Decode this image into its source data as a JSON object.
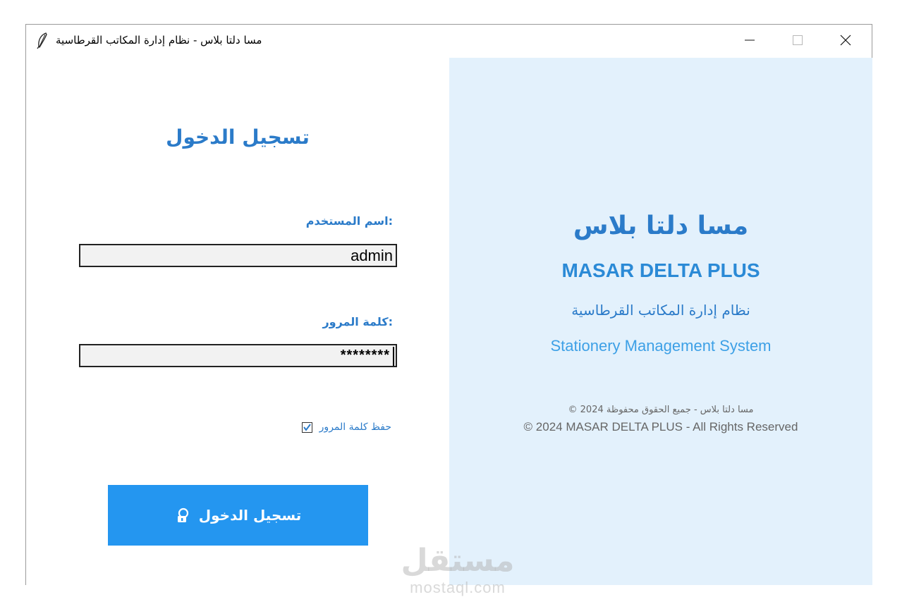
{
  "window": {
    "title": "مسا دلتا بلاس - نظام إدارة المكاتب القرطاسية",
    "icon": "feather-icon",
    "controls": [
      "minimize-icon",
      "maximize-icon",
      "close-icon"
    ]
  },
  "login": {
    "title": "تسجيل الدخول",
    "username_label": ":اسم المستخدم",
    "username_value": "admin",
    "password_label": ":كلمة المرور",
    "password_value": "********",
    "remember_label": "حفظ كلمة المرور",
    "remember_checked": true,
    "button_label": "تسجيل الدخول",
    "button_icon": "user-lock-icon",
    "button_color": "#2496f0"
  },
  "brand": {
    "name_ar": "مسا دلتا بلاس",
    "name_en": "MASAR DELTA PLUS",
    "subtitle_ar": "نظام إدارة المكاتب القرطاسية",
    "subtitle_en": "Stationery Management System",
    "copyright_ar": "مسا دلتا بلاس - جميع الحقوق محفوظة 2024 ©",
    "copyright_en": "© 2024 MASAR DELTA PLUS - All Rights Reserved",
    "accent_color": "#2b7bc9",
    "panel_color": "#e3f1fc"
  },
  "watermark": {
    "text_ar": "مستقل",
    "text_en": "mostaql.com"
  }
}
